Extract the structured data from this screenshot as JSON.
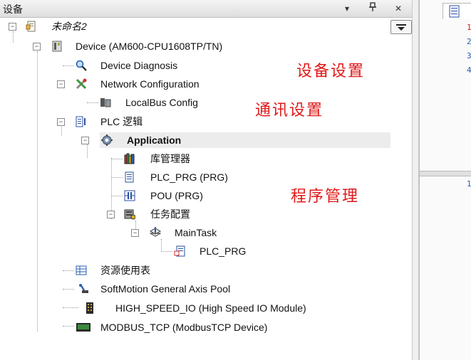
{
  "panel": {
    "title": "设备",
    "buttons": {
      "dropdown": "▾",
      "pin": "ᵖ",
      "close": "✕"
    }
  },
  "tree": {
    "root": "未命名2",
    "device": "Device (AM600-CPU1608TP/TN)",
    "device_diagnosis": "Device Diagnosis",
    "network_configuration": "Network Configuration",
    "localbus_config": "LocalBus Config",
    "plc_logic": "PLC 逻辑",
    "application": "Application",
    "library_manager": "库管理器",
    "plc_prg": "PLC_PRG (PRG)",
    "pou": "POU (PRG)",
    "task_config": "任务配置",
    "main_task": "MainTask",
    "main_task_prg": "PLC_PRG",
    "resource_table": "资源使用表",
    "softmotion": "SoftMotion General Axis Pool",
    "high_speed_io": "HIGH_SPEED_IO (High Speed IO Module)",
    "modbus_tcp": "MODBUS_TCP (ModbusTCP Device)"
  },
  "annotations": {
    "device_settings": "设备设置",
    "comm_settings": "通讯设置",
    "program_management": "程序管理"
  },
  "right_pane": {
    "line_numbers": [
      "1",
      "2",
      "3",
      "4"
    ],
    "lower_line_number": "1"
  },
  "colors": {
    "annotation_red": "#e01818",
    "selection": "#ececec"
  }
}
